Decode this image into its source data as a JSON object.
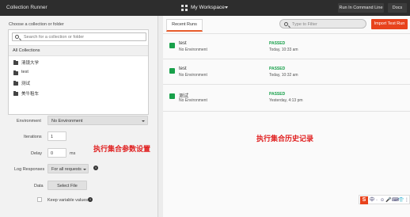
{
  "topbar": {
    "app_title": "Collection Runner",
    "workspace": "My Workspace",
    "run_in_cmd": "Run In Command Line",
    "docs": "Docs"
  },
  "left": {
    "choose_label": "Choose a collection or folder",
    "search_placeholder": "Search for a collection or folder",
    "all_collections": "All Collections",
    "collections": [
      "清镜大学",
      "test",
      "测试",
      "美牛租车"
    ],
    "environment_label": "Environment",
    "environment_value": "No Environment",
    "iterations_label": "Iterations",
    "iterations_value": "1",
    "delay_label": "Delay",
    "delay_value": "0",
    "delay_unit": "ms",
    "log_label": "Log Responses",
    "log_value": "For all requests",
    "data_label": "Data",
    "select_file": "Select File",
    "keep_vars": "Keep variable values",
    "annotation": "执行集合参数设置"
  },
  "right": {
    "tab": "Recent Runs",
    "filter_placeholder": "Type to Filter",
    "import_btn": "Import Test Run",
    "runs": [
      {
        "name": "test",
        "env": "No Environment",
        "status": "PASSED",
        "time": "Today, 10:33 am"
      },
      {
        "name": "test",
        "env": "No Environment",
        "status": "PASSED",
        "time": "Today, 10:32 am"
      },
      {
        "name": "测试",
        "env": "No Environment",
        "status": "PASSED",
        "time": "Yesterday, 4:13 pm"
      }
    ],
    "annotation": "执行集合历史记录"
  },
  "ime_toolbar": {
    "logo": "S",
    "items": [
      "中",
      "·",
      "☺",
      "🎤",
      "⌨",
      "👕",
      "⋮⋮"
    ]
  },
  "colors": {
    "accent": "#e8431d",
    "passed": "#18a04a",
    "annotation": "#e02020",
    "topbar": "#2d2d2d"
  }
}
